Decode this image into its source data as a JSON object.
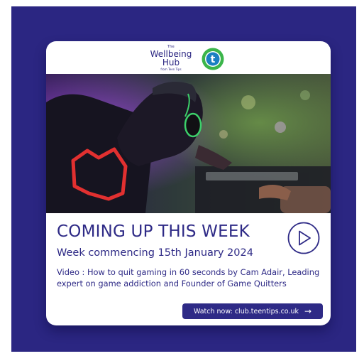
{
  "logo": {
    "the": "The",
    "line1": "Wellbeing",
    "line2": "Hub",
    "tagline": "from Teen Tips",
    "badge_letter": "t",
    "icon": "teentips-badge-icon"
  },
  "photo": {
    "icon": "gamer-with-headset-image"
  },
  "content": {
    "heading": "COMING UP THIS WEEK",
    "subheading": "Week commencing 15th January 2024",
    "description": "Video : How to quit gaming in 60 seconds by Cam Adair, Leading expert on game addiction and Founder of Game Quitters"
  },
  "play_button": {
    "icon": "play-icon"
  },
  "cta": {
    "label": "Watch now: club.teentips.co.uk",
    "arrow": "→",
    "icon": "arrow-right-icon"
  },
  "colors": {
    "panel_background": "#2b2682",
    "brand_navy": "#2e2a86",
    "badge_green": "#3bb54a",
    "badge_blue": "#1a7fc1"
  }
}
